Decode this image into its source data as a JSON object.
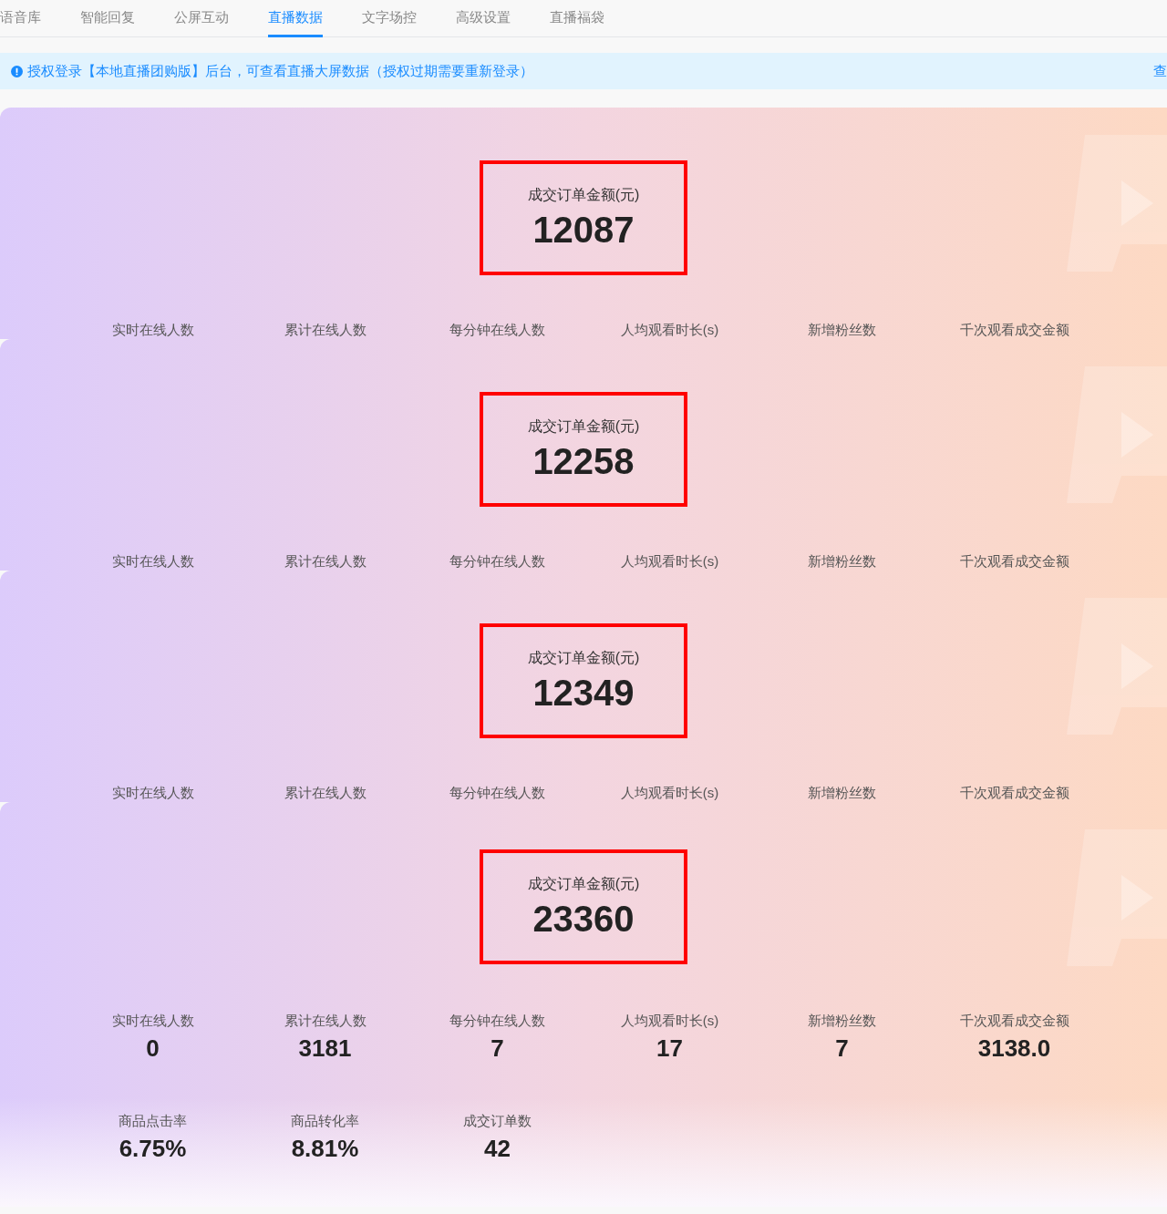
{
  "tabs": [
    {
      "label": "语音库",
      "selected": false
    },
    {
      "label": "智能回复",
      "selected": false
    },
    {
      "label": "公屏互动",
      "selected": false
    },
    {
      "label": "直播数据",
      "selected": true
    },
    {
      "label": "文字场控",
      "selected": false
    },
    {
      "label": "高级设置",
      "selected": false
    },
    {
      "label": "直播福袋",
      "selected": false
    }
  ],
  "notice": {
    "text": "授权登录【本地直播团购版】后台，可查看直播大屏数据（授权过期需要重新登录）",
    "link": "查"
  },
  "panels": [
    {
      "amount_title": "成交订单金额(元)",
      "amount": "12087",
      "metrics": [
        {
          "label": "实时在线人数"
        },
        {
          "label": "累计在线人数"
        },
        {
          "label": "每分钟在线人数"
        },
        {
          "label": "人均观看时长(s)"
        },
        {
          "label": "新增粉丝数"
        },
        {
          "label": "千次观看成交金额"
        }
      ]
    },
    {
      "amount_title": "成交订单金额(元)",
      "amount": "12258",
      "metrics": [
        {
          "label": "实时在线人数"
        },
        {
          "label": "累计在线人数"
        },
        {
          "label": "每分钟在线人数"
        },
        {
          "label": "人均观看时长(s)"
        },
        {
          "label": "新增粉丝数"
        },
        {
          "label": "千次观看成交金额"
        }
      ]
    },
    {
      "amount_title": "成交订单金额(元)",
      "amount": "12349",
      "metrics": [
        {
          "label": "实时在线人数"
        },
        {
          "label": "累计在线人数"
        },
        {
          "label": "每分钟在线人数"
        },
        {
          "label": "人均观看时长(s)"
        },
        {
          "label": "新增粉丝数"
        },
        {
          "label": "千次观看成交金额"
        }
      ]
    },
    {
      "amount_title": "成交订单金额(元)",
      "amount": "23360",
      "metrics": [
        {
          "label": "实时在线人数",
          "value": "0"
        },
        {
          "label": "累计在线人数",
          "value": "3181"
        },
        {
          "label": "每分钟在线人数",
          "value": "7"
        },
        {
          "label": "人均观看时长(s)",
          "value": "17"
        },
        {
          "label": "新增粉丝数",
          "value": "7"
        },
        {
          "label": "千次观看成交金额",
          "value": "3138.0"
        },
        {
          "label": "商品点击率",
          "value": "6.75%"
        },
        {
          "label": "商品转化率",
          "value": "8.81%"
        },
        {
          "label": "成交订单数",
          "value": "42"
        }
      ]
    }
  ]
}
